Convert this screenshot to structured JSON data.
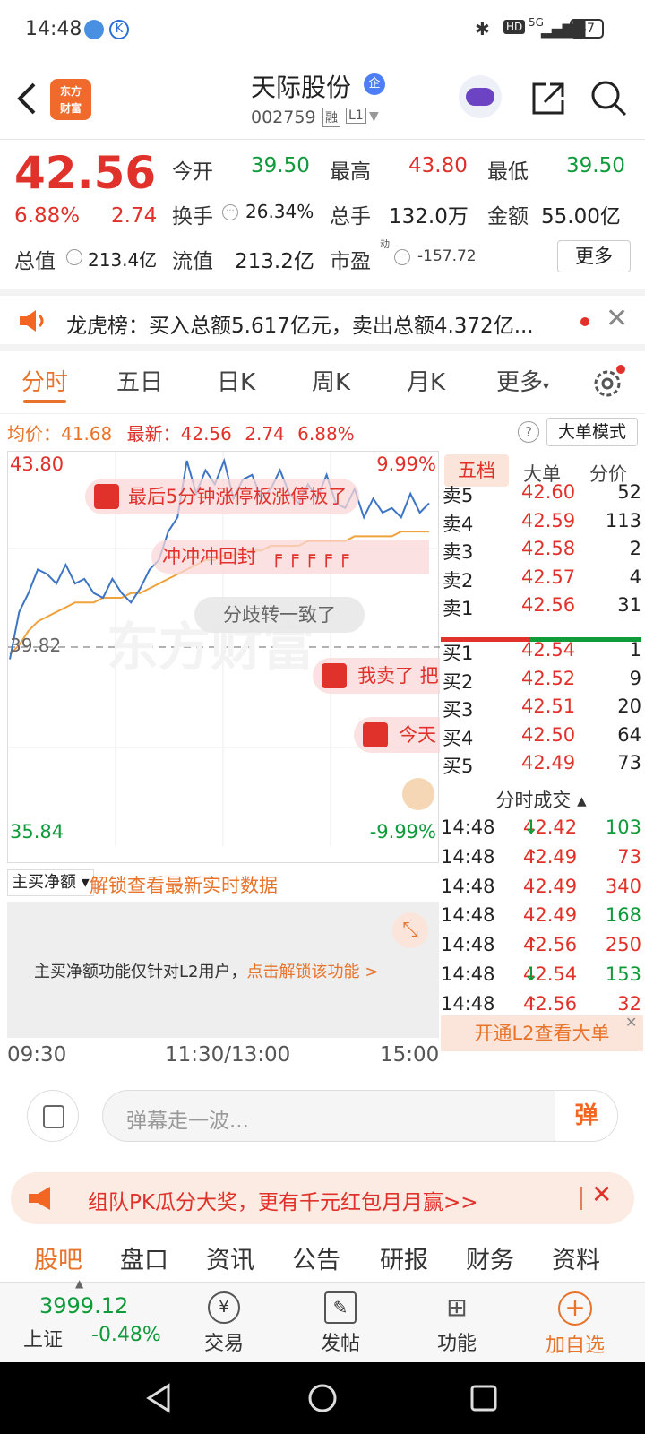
{
  "status": {
    "time": "14:48",
    "battery": "37",
    "network": "5G"
  },
  "header": {
    "logo_line1": "东方",
    "logo_line2": "财富",
    "title": "天际股份",
    "badge": "企",
    "code": "002759",
    "tag_rong": "融",
    "tag_l1": "L1"
  },
  "quote": {
    "price": "42.56",
    "pct": "6.88%",
    "chg": "2.74",
    "open_label": "今开",
    "open": "39.50",
    "high_label": "最高",
    "high": "43.80",
    "low_label": "最低",
    "low": "39.50",
    "turnover_label": "换手",
    "turnover": "26.34%",
    "volume_label": "总手",
    "volume": "132.0万",
    "amount_label": "金额",
    "amount": "55.00亿",
    "mcap_label": "总值",
    "mcap": "213.4亿",
    "float_label": "流值",
    "float": "213.2亿",
    "pe_label": "市盈",
    "pe_sup": "动",
    "pe": "-157.72",
    "more_label": "更多"
  },
  "lhb": {
    "text": "龙虎榜：买入总额5.617亿元，卖出总额4.372亿..."
  },
  "tabs": [
    "分时",
    "五日",
    "日K",
    "周K",
    "月K",
    "更多"
  ],
  "chart_info": {
    "avg_label": "均价：",
    "avg": "41.68",
    "latest_label": "最新：",
    "latest": "42.56",
    "chg": "2.74",
    "pct": "6.88%",
    "mode_btn": "大单模式"
  },
  "chart_data": {
    "type": "line",
    "y_max": "43.80",
    "y_mid": "39.82",
    "y_min": "35.84",
    "pct_max": "9.99%",
    "pct_min": "-9.99%",
    "x_labels": [
      "09:30",
      "11:30/13:00",
      "15:00"
    ],
    "price": [
      39.6,
      40.6,
      41.0,
      41.5,
      41.4,
      41.2,
      41.6,
      41.2,
      41.3,
      41.0,
      40.9,
      41.3,
      41.0,
      40.8,
      41.1,
      41.5,
      41.7,
      42.3,
      42.6,
      43.8,
      43.1,
      43.6,
      43.3,
      43.8,
      43.0,
      43.4,
      43.5,
      43.0,
      43.2,
      43.6,
      43.1,
      42.9,
      43.3,
      43.0,
      43.5,
      42.9,
      42.8,
      43.2,
      42.6,
      43.0,
      42.7,
      42.8,
      42.6,
      43.1,
      42.7,
      42.9
    ],
    "avg": [
      39.7,
      39.9,
      40.2,
      40.4,
      40.5,
      40.6,
      40.7,
      40.8,
      40.8,
      40.8,
      40.9,
      40.9,
      40.9,
      41.0,
      41.0,
      41.1,
      41.2,
      41.3,
      41.4,
      41.5,
      41.6,
      41.7,
      41.7,
      41.8,
      41.8,
      41.9,
      41.9,
      41.9,
      42.0,
      42.0,
      42.0,
      42.0,
      42.1,
      42.1,
      42.1,
      42.1,
      42.1,
      42.2,
      42.2,
      42.2,
      42.2,
      42.2,
      42.3,
      42.3,
      42.3,
      42.3
    ]
  },
  "danmu": [
    "最后5分钟涨停板涨停板了",
    "冲冲冲回封",
    "分歧转一致了",
    "我卖了 把",
    "今天"
  ],
  "watermark": "东方财富",
  "orderbook": {
    "tabs": [
      "五档",
      "大单",
      "分价"
    ],
    "sells": [
      {
        "l": "卖5",
        "p": "42.60",
        "v": "52"
      },
      {
        "l": "卖4",
        "p": "42.59",
        "v": "113"
      },
      {
        "l": "卖3",
        "p": "42.58",
        "v": "2"
      },
      {
        "l": "卖2",
        "p": "42.57",
        "v": "4"
      },
      {
        "l": "卖1",
        "p": "42.56",
        "v": "31"
      }
    ],
    "buys": [
      {
        "l": "买1",
        "p": "42.54",
        "v": "1"
      },
      {
        "l": "买2",
        "p": "42.52",
        "v": "9"
      },
      {
        "l": "买3",
        "p": "42.51",
        "v": "20"
      },
      {
        "l": "买4",
        "p": "42.50",
        "v": "64"
      },
      {
        "l": "买5",
        "p": "42.49",
        "v": "73"
      }
    ],
    "ticks_title": "分时成交",
    "ticks": [
      {
        "t": "14:48",
        "p": "42.42",
        "a": "↓",
        "v": "103",
        "c": "g"
      },
      {
        "t": "14:48",
        "p": "42.49",
        "a": "↑",
        "v": "73",
        "c": "r"
      },
      {
        "t": "14:48",
        "p": "42.49",
        "a": "",
        "v": "340",
        "c": "r"
      },
      {
        "t": "14:48",
        "p": "42.49",
        "a": "",
        "v": "168",
        "c": "g"
      },
      {
        "t": "14:48",
        "p": "42.56",
        "a": "↑",
        "v": "250",
        "c": "r"
      },
      {
        "t": "14:48",
        "p": "42.54",
        "a": "↓",
        "v": "153",
        "c": "g"
      },
      {
        "t": "14:48",
        "p": "42.56",
        "a": "↑",
        "v": "32",
        "c": "r"
      }
    ],
    "l2_btn": "开通L2查看大单"
  },
  "netbuy": {
    "select": "主买净额",
    "unlock": "解锁查看最新实时数据",
    "note": "主买净额功能仅针对L2用户，",
    "link": "点击解锁该功能 >"
  },
  "input": {
    "placeholder": "弹幕走一波...",
    "send": "弹"
  },
  "promo": {
    "text": "组队PK瓜分大奖，更有千元红包月月赢>>"
  },
  "subtabs": [
    "股吧",
    "盘口",
    "资讯",
    "公告",
    "研报",
    "财务",
    "资料"
  ],
  "bottom": {
    "index_value": "3999.12",
    "index_name": "上证",
    "index_pct": "-0.48%",
    "trade": "交易",
    "post": "发帖",
    "func": "功能",
    "add": "加自选"
  },
  "colors": {
    "red": "#e0312a",
    "green": "#0f9b3a",
    "orange": "#e8732a",
    "price_line": "#3d74c4",
    "avg_line": "#f0a23c"
  }
}
